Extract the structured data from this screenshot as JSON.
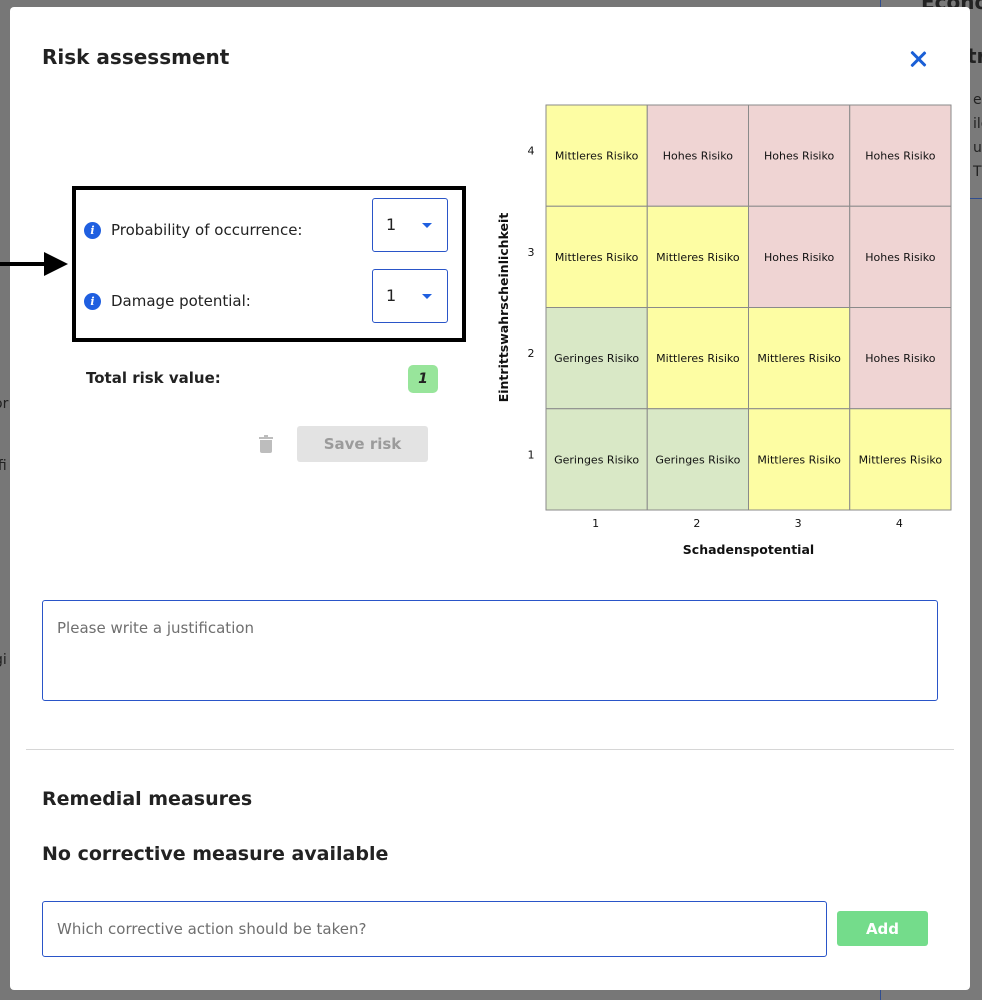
{
  "background": {
    "right_title": "Econo",
    "right_heading": "tr",
    "right_lines": [
      "en",
      "ilo",
      "ul",
      "TS"
    ],
    "left_fragments": [
      "or",
      "ifi",
      "gi"
    ]
  },
  "modal": {
    "title": "Risk assessment",
    "fields": [
      {
        "label": "Probability of occurrence:",
        "value": "1"
      },
      {
        "label": "Damage potential:",
        "value": "1"
      }
    ],
    "total_label": "Total risk value:",
    "total_value": "1",
    "save_label": "Save risk",
    "justification_placeholder": "Please write a justification",
    "remedial_title": "Remedial measures",
    "no_measures_text": "No corrective measure available",
    "action_placeholder": "Which corrective action should be taken?",
    "add_label": "Add"
  },
  "matrix": {
    "y_axis_label": "Eintrittswahrscheinlichkeit",
    "x_axis_label": "Schadenspotential",
    "x_ticks": [
      "1",
      "2",
      "3",
      "4"
    ],
    "y_ticks": [
      "4",
      "3",
      "2",
      "1"
    ],
    "rows": [
      [
        "Mittleres Risiko",
        "Hohes Risiko",
        "Hohes Risiko",
        "Hohes Risiko"
      ],
      [
        "Mittleres Risiko",
        "Mittleres Risiko",
        "Hohes Risiko",
        "Hohes Risiko"
      ],
      [
        "Geringes Risiko",
        "Mittleres Risiko",
        "Mittleres Risiko",
        "Hohes Risiko"
      ],
      [
        "Geringes Risiko",
        "Geringes Risiko",
        "Mittleres Risiko",
        "Mittleres Risiko"
      ]
    ],
    "colors": {
      "Geringes Risiko": "#d9e8c6",
      "Mittleres Risiko": "#fdfda3",
      "Hohes Risiko": "#efd4d3"
    }
  }
}
